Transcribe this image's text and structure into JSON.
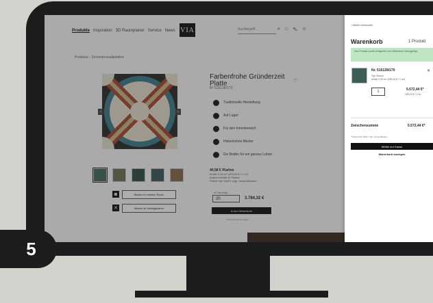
{
  "step": {
    "number": "5"
  },
  "shop": {
    "nav": [
      "Produkte",
      "Inspiration",
      "3D Raumplaner",
      "Service",
      "News"
    ],
    "logo": "VIA",
    "search_placeholder": "Suchbegriff...",
    "breadcrumb": "Produkte  ›  Zementmosaikplatten",
    "product": {
      "title": "Farbenfrohe Gründerzeit Platte",
      "sku": "Nº 515128/170",
      "features": [
        "Traditionelle Herstellung",
        "Auf Lager",
        "Für den Innenbereich",
        "Historisches Muster",
        "Ein Boden für ein ganzes Leben"
      ],
      "price": "40,58 € /Karton",
      "price_details": [
        "Inhalt: 0,25 m² (159,24 € / 1 m²)",
        "Karton enthält 10 Platten",
        "Preise inkl. MwSt. zzgl. Versandkosten"
      ],
      "qty_label": "m² benötigt",
      "qty_value": "20",
      "qty_total": "3.784,32 €",
      "add_to_cart": "In den Warenkorb",
      "ship_note": "Versandkosten anzeigen",
      "actions": [
        "Muster in meinem Raum",
        "Muster im Verlegeplaner"
      ]
    }
  },
  "cart": {
    "back": "‹ Weiter einkaufen",
    "title": "Warenkorb",
    "count": "1 Produkt",
    "notice": "Das Produkt wurde erfolgreich zum Warenkorb hinzugefügt.",
    "item": {
      "name": "Nr. 515128/170",
      "type": "Typ: Kanon",
      "meta": "Inhalt: 0,25 m² (159,24 € / 1 m²)",
      "qty": "1",
      "price": "5.572,44 €*",
      "subprice": "159,24 € / 1 m²"
    },
    "sum_label": "Zwischensumme",
    "sum_value": "5.572,44 €*",
    "sum_note": "* Preise inkl. MwSt. zzgl. Versandkosten",
    "checkout": "Weiter zur Kasse",
    "continue": "Warenkorb anzeigen"
  }
}
